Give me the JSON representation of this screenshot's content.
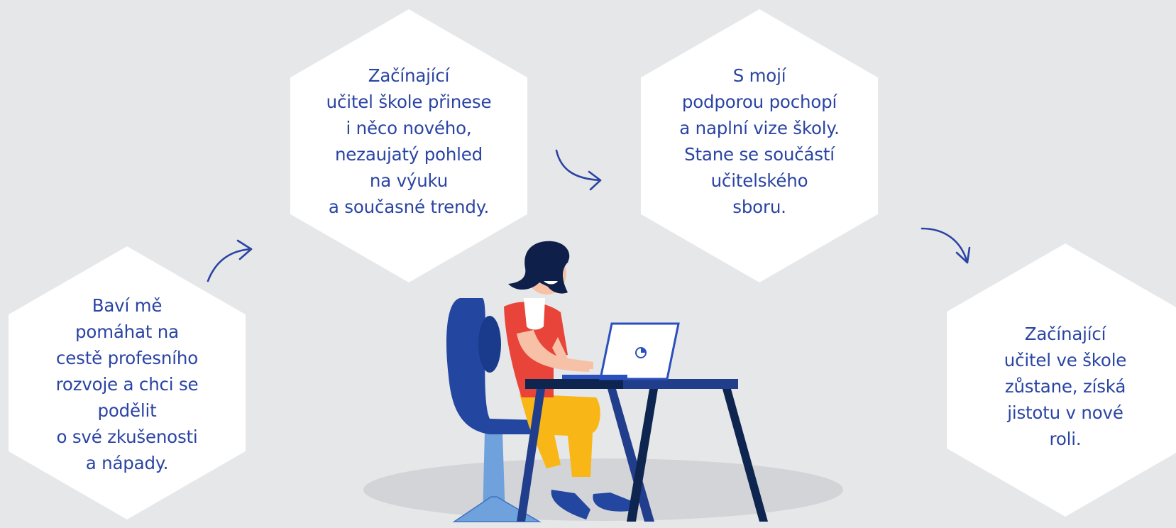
{
  "steps": [
    {
      "text": "Baví mě\npomáhat na\ncestě profesního\nrozvoje a chci se\npodělit\no své zkušenosti\na nápady."
    },
    {
      "text": "Začínající\nučitel škole přinese\ni něco nového,\nnezaujatý pohled\nna výuku\na současné trendy."
    },
    {
      "text": "S mojí\npodporou pochopí\na naplní vize školy.\nStane se součástí\nučitelského\nsboru."
    },
    {
      "text": "Začínající\nučitel ve škole\nzůstane, získá\njistotu v nové\nroli."
    }
  ],
  "colors": {
    "background": "#e6e7e9",
    "hexagon": "#ffffff",
    "text": "#2a44a3",
    "arrow": "#2a44a3",
    "chair": "#2346a0",
    "shirt": "#e8443a",
    "pants": "#f8b716",
    "desk": "#213e8c",
    "laptop_outline": "#2a4fbf"
  },
  "icons": [
    "arrow-icon",
    "teacher-illustration",
    "laptop-icon",
    "desk-icon",
    "chair-icon"
  ]
}
